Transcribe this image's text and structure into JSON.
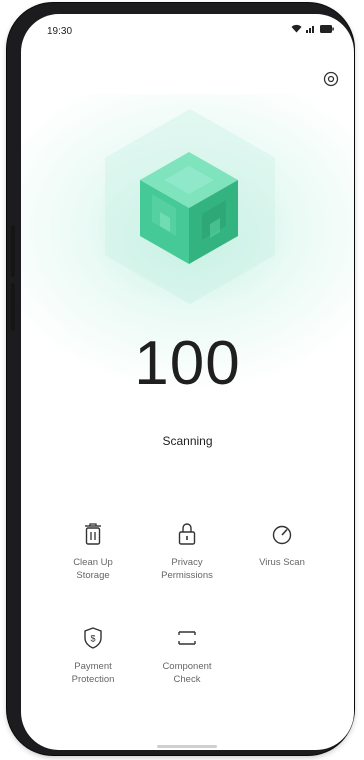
{
  "status_bar": {
    "time": "19:30",
    "icons": [
      "wifi-icon",
      "signal-icon",
      "battery-icon"
    ]
  },
  "header": {
    "settings_icon": "settings-icon"
  },
  "scan": {
    "score": "100",
    "status": "Scanning"
  },
  "tools": [
    {
      "icon": "trash-icon",
      "label_line1": "Clean Up",
      "label_line2": "Storage"
    },
    {
      "icon": "lock-icon",
      "label_line1": "Privacy",
      "label_line2": "Permissions"
    },
    {
      "icon": "speedometer-icon",
      "label_line1": "Virus Scan",
      "label_line2": ""
    },
    {
      "icon": "shield-dollar-icon",
      "label_line1": "Payment",
      "label_line2": "Protection"
    },
    {
      "icon": "component-icon",
      "label_line1": "Component",
      "label_line2": "Check"
    }
  ],
  "colors": {
    "accent": "#4fc99a",
    "text": "#1f1f1f",
    "muted": "#666666"
  }
}
